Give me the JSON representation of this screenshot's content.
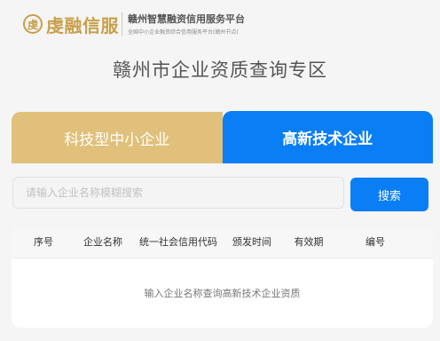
{
  "header": {
    "logo_mark": "虔",
    "logo_text": "虔融信服",
    "platform_name": "赣州智慧融资信用服务平台",
    "platform_subtitle": "全国中小企业融资综合信用服务平台(赣州节点)"
  },
  "page": {
    "title": "赣州市企业资质查询专区"
  },
  "tabs": [
    {
      "label": "科技型中小企业",
      "active": false
    },
    {
      "label": "高新技术企业",
      "active": true
    }
  ],
  "search": {
    "placeholder": "请输入企业名称模糊搜索",
    "value": "",
    "button_label": "搜索"
  },
  "table": {
    "columns": [
      "序号",
      "企业名称",
      "统一社会信用代码",
      "颁发时间",
      "有效期",
      "编号"
    ],
    "rows": [],
    "empty_message": "输入企业名称查询高新技术企业资质"
  },
  "colors": {
    "brand_gold": "#c8a04a",
    "tab_gold": "#e0c07a",
    "primary_blue": "#0a7ef4",
    "background": "#f5f5f5"
  }
}
